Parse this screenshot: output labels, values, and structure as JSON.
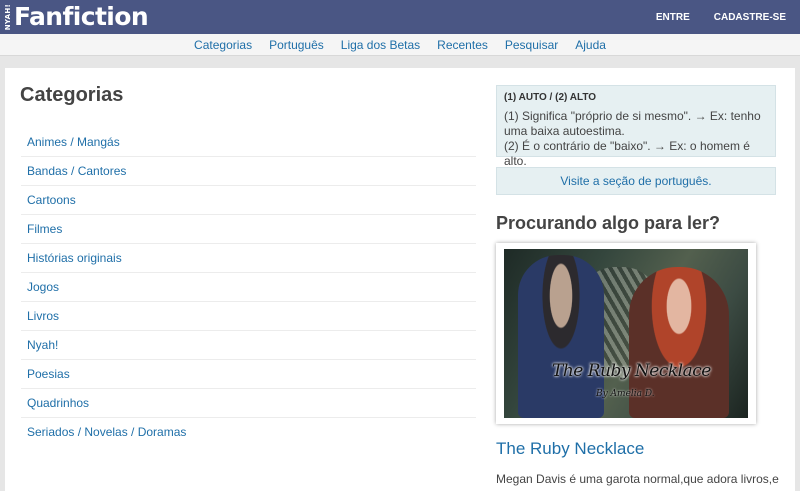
{
  "header": {
    "logo_small": "NYAH!",
    "logo_main": "Fanfiction",
    "login": "ENTRE",
    "signup": "CADASTRE-SE"
  },
  "nav": {
    "items": [
      "Categorias",
      "Português",
      "Liga dos Betas",
      "Recentes",
      "Pesquisar",
      "Ajuda"
    ]
  },
  "main": {
    "title": "Categorias",
    "categories": [
      "Animes / Mangás",
      "Bandas / Cantores",
      "Cartoons",
      "Filmes",
      "Histórias originais",
      "Jogos",
      "Livros",
      "Nyah!",
      "Poesias",
      "Quadrinhos",
      "Seriados / Novelas / Doramas"
    ]
  },
  "sidebar": {
    "tip_title": "(1) AUTO / (2) ALTO",
    "tip_line1": "(1) Significa \"próprio de si mesmo\". → Ex: tenho uma baixa autoestima.",
    "tip_line2": "(2) É o contrário de \"baixo\". → Ex: o homem é alto.",
    "tip_link": "Visite a seção de português.",
    "heading": "Procurando algo para ler?",
    "cover_title": "The Ruby Necklace",
    "cover_author": "By Amelia D.",
    "story_title": "The Ruby Necklace",
    "story_desc": "Megan Davis é uma garota normal,que adora livros,e vi-"
  },
  "colors": {
    "header_bg": "#4a5684",
    "link": "#1f6fa8",
    "tip_bg": "#e6f0f2"
  }
}
